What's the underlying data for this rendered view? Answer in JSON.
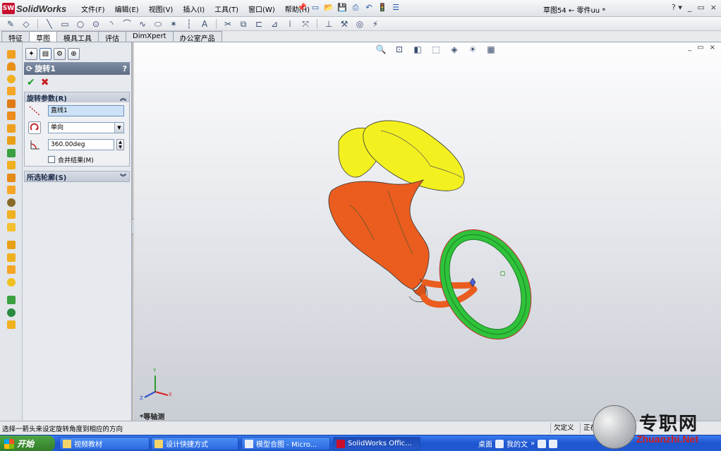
{
  "app": {
    "name": "SolidWorks",
    "logo_text": "SW"
  },
  "menu": [
    "文件(F)",
    "编辑(E)",
    "视图(V)",
    "插入(I)",
    "工具(T)",
    "窗口(W)",
    "帮助(H)"
  ],
  "doc_title": "草图54 ← 零件uu *",
  "window_controls": {
    "help": "? ▾",
    "minimize": "_",
    "restore": "▭",
    "close": "×"
  },
  "command_tabs": [
    "特征",
    "草图",
    "模具工具",
    "评估",
    "DimXpert",
    "办公室产品"
  ],
  "active_command_tab": "草图",
  "property_manager": {
    "title": "旋转1",
    "help": "?",
    "ok_icon": "checkmark-icon",
    "cancel_icon": "x-icon",
    "group_params": {
      "title": "旋转参数(R)",
      "axis_value": "直线1",
      "direction_value": "单向",
      "angle_value": "360.00deg",
      "merge_label": "合并结果(M)",
      "merge_checked": false
    },
    "group_contours": {
      "title": "所选轮廓(S)"
    }
  },
  "graphics": {
    "view_label": "*等轴测",
    "triad": {
      "x": "X",
      "y": "Y",
      "z": "Z"
    },
    "colors": {
      "yellow": "#f3f020",
      "orange": "#ea5d1f",
      "green": "#2fc23a"
    }
  },
  "status": {
    "message": "选择一箭头来设定旋转角度到相应的方向",
    "state": "欠定义",
    "editing": "正在"
  },
  "taskbar": {
    "start": "开始",
    "items": [
      "视频教材",
      "设计快捷方式",
      "模型合图 - Micro...",
      "SolidWorks Offic..."
    ],
    "tray_desktop": "桌面",
    "tray_doc": "我的文"
  },
  "watermark": {
    "cn": "专职网",
    "url": "Zhuanzhi.Net"
  }
}
